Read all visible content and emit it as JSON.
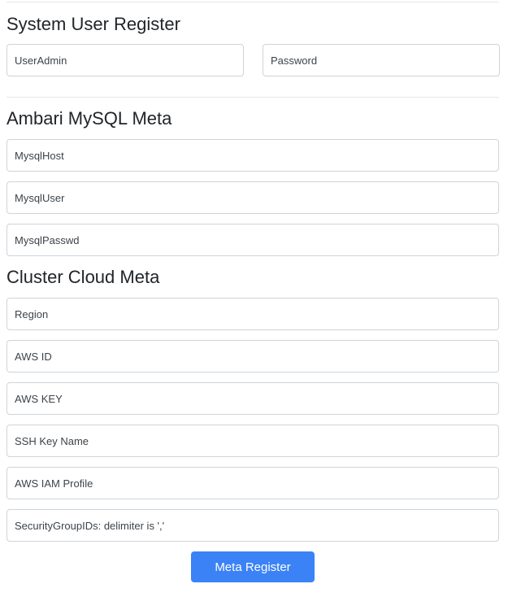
{
  "system_user": {
    "title": "System User Register",
    "user_admin_placeholder": "UserAdmin",
    "password_placeholder": "Password"
  },
  "ambari_mysql": {
    "title": "Ambari MySQL Meta",
    "host_placeholder": "MysqlHost",
    "user_placeholder": "MysqlUser",
    "passwd_placeholder": "MysqlPasswd"
  },
  "cluster_cloud": {
    "title": "Cluster Cloud Meta",
    "region_placeholder": "Region",
    "aws_id_placeholder": "AWS ID",
    "aws_key_placeholder": "AWS KEY",
    "ssh_key_name_placeholder": "SSH Key Name",
    "aws_iam_profile_placeholder": "AWS IAM Profile",
    "security_group_ids_placeholder": "SecurityGroupIDs: delimiter is ','"
  },
  "actions": {
    "meta_register_label": "Meta Register"
  },
  "colors": {
    "primary_button": "#3b82f6",
    "input_border": "#ced4da",
    "divider": "#e4e6e8"
  }
}
